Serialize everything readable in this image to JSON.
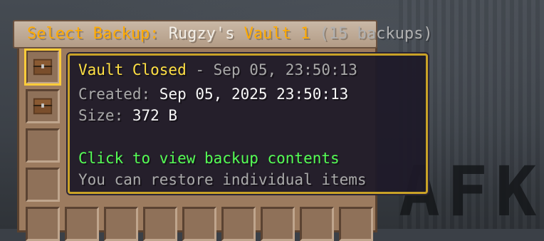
{
  "title": {
    "prefix": "Select Backup:",
    "player": "Rugzy's",
    "vault_name": "Vault 1",
    "count": "(15 backups)"
  },
  "background": {
    "sign_text": "AFK"
  },
  "slots": [
    {
      "name": "slot-backup-1",
      "icon": "chest-icon",
      "selected": true
    },
    {
      "name": "slot-backup-2",
      "icon": "chest-icon",
      "selected": false
    }
  ],
  "tooltip": {
    "status": "Vault Closed",
    "separator": " - ",
    "timestamp": "Sep 05, 23:50:13",
    "created_label": "Created: ",
    "created_value": "Sep 05, 2025 23:50:13",
    "size_label": "Size: ",
    "size_value": "372 B",
    "action_hint": "Click to view backup contents",
    "restore_hint": "You can restore individual items"
  },
  "colors": {
    "accent_orange": "#ffaa00",
    "status_yellow": "#ffe044",
    "hint_green": "#55ff55",
    "tooltip_border": "#c9a227"
  }
}
